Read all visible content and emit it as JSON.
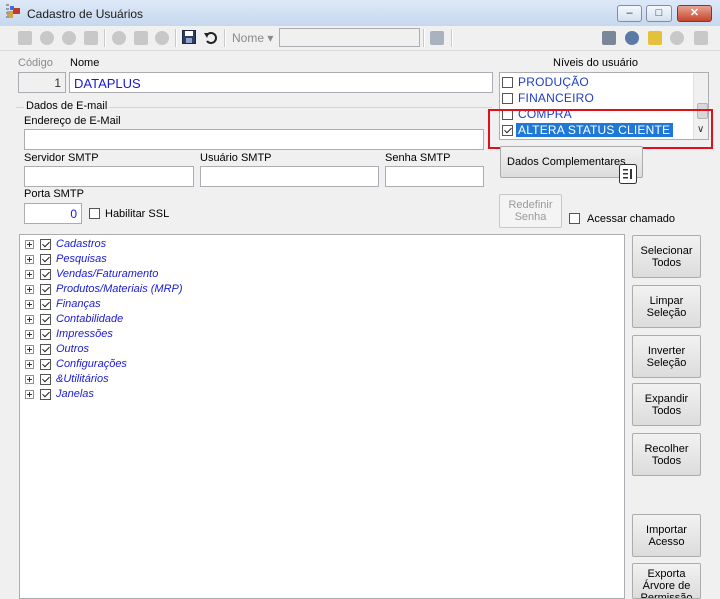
{
  "window": {
    "title": "Cadastro de Usuários"
  },
  "toolbar": {
    "filter_field": "Nome"
  },
  "form": {
    "codigo_label": "Código",
    "codigo_value": "1",
    "nome_label": "Nome",
    "nome_value": "DATAPLUS",
    "niveis_label": "Níveis do usuário",
    "email_group": "Dados de E-mail",
    "email_label": "Endereço de E-Mail",
    "smtp_server_label": "Servidor SMTP",
    "smtp_user_label": "Usuário SMTP",
    "smtp_password_label": "Senha SMTP",
    "smtp_port_label": "Porta SMTP",
    "smtp_port_value": "0",
    "ssl_label": "Habilitar SSL",
    "dados_complementares": "Dados Complementares",
    "redefinir_senha": "Redefinir\nSenha",
    "acessar_chamado": "Acessar chamado"
  },
  "levels": [
    {
      "label": "PRODUÇÃO",
      "checked": false
    },
    {
      "label": "FINANCEIRO",
      "checked": false
    },
    {
      "label": "COMPRA",
      "checked": false
    },
    {
      "label": "ALTERA STATUS CLIENTE",
      "checked": true,
      "selected": true
    }
  ],
  "tree": [
    "Cadastros",
    "Pesquisas",
    "Vendas/Faturamento",
    "Produtos/Materiais (MRP)",
    "Finanças",
    "Contabilidade",
    "Impressões",
    "Outros",
    "Configurações",
    "&Utilitários",
    "Janelas"
  ],
  "actions": [
    "Selecionar\nTodos",
    "Limpar\nSeleção",
    "Inverter\nSeleção",
    "Expandir\nTodos",
    "Recolher\nTodos",
    "Importar\nAcesso",
    "Exporta\nÁrvore de\nPermissão"
  ],
  "colors": {
    "highlight_box": "#e0101e",
    "selection": "#1e78d7",
    "link_text": "#1a1ad6"
  }
}
